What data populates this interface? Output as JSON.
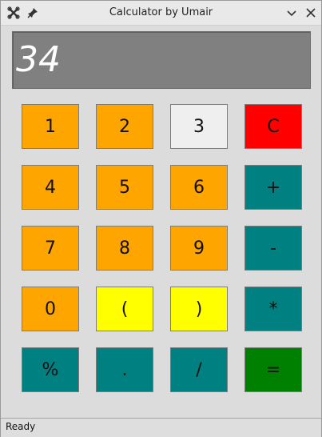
{
  "window": {
    "title": "Calculator by Umair",
    "icons": [
      "close-x-app-icon",
      "pin-icon",
      "minimize-chevron-icon",
      "close-icon"
    ]
  },
  "display": {
    "value": "34"
  },
  "keys": [
    {
      "label": "1",
      "color": "#FFA500"
    },
    {
      "label": "2",
      "color": "#FFA500"
    },
    {
      "label": "3",
      "color": "#EFEFEF"
    },
    {
      "label": "C",
      "color": "#FF0000"
    },
    {
      "label": "4",
      "color": "#FFA500"
    },
    {
      "label": "5",
      "color": "#FFA500"
    },
    {
      "label": "6",
      "color": "#FFA500"
    },
    {
      "label": "+",
      "color": "#008080"
    },
    {
      "label": "7",
      "color": "#FFA500"
    },
    {
      "label": "8",
      "color": "#FFA500"
    },
    {
      "label": "9",
      "color": "#FFA500"
    },
    {
      "label": "-",
      "color": "#008080"
    },
    {
      "label": "0",
      "color": "#FFA500"
    },
    {
      "label": "(",
      "color": "#FFFF00"
    },
    {
      "label": ")",
      "color": "#FFFF00"
    },
    {
      "label": "*",
      "color": "#008080"
    },
    {
      "label": "%",
      "color": "#008080"
    },
    {
      "label": ".",
      "color": "#008080"
    },
    {
      "label": "/",
      "color": "#008080"
    },
    {
      "label": "=",
      "color": "#008000"
    }
  ],
  "statusbar": {
    "text": "Ready"
  }
}
